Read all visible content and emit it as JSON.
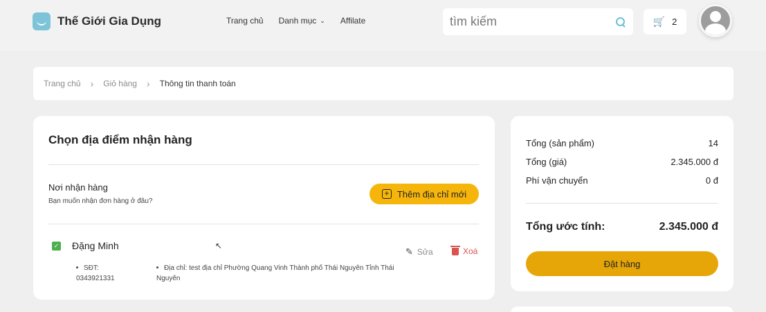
{
  "header": {
    "brand": "Thế Giới Gia Dụng",
    "nav": [
      {
        "label": "Trang chủ"
      },
      {
        "label": "Danh mục"
      },
      {
        "label": "Affilate"
      }
    ],
    "search": {
      "placeholder": "tìm kiếm"
    },
    "cart_count": "2"
  },
  "breadcrumb": {
    "items": [
      "Trang chủ",
      "Giỏ hàng"
    ],
    "current": "Thông tin thanh toán"
  },
  "address_panel": {
    "title": "Chọn địa điểm nhận hàng",
    "section_title": "Nơi nhận hàng",
    "section_sub": "Bạn muốn nhận đơn hàng ở đâu?",
    "add_button": "Thêm địa chỉ mới",
    "entry": {
      "name": "Đặng Minh",
      "selected": true,
      "phone_label": "SĐT:",
      "phone": "0343921331",
      "address_label": "Địa chỉ:",
      "address": "test địa chỉ Phường Quang Vinh Thành phố Thái Nguyên Tỉnh Thái Nguyên",
      "edit_label": "Sửa",
      "delete_label": "Xoá"
    }
  },
  "summary": {
    "rows": [
      {
        "label": "Tổng (sản phẩm)",
        "value": "14"
      },
      {
        "label": "Tổng (giá)",
        "value": "2.345.000 đ"
      },
      {
        "label": "Phí vận chuyển",
        "value": "0 đ"
      }
    ],
    "total_label": "Tổng ước tính:",
    "total_value": "2.345.000 đ",
    "order_button": "Đặt hàng"
  },
  "colors": {
    "accent": "#f5b50b",
    "order_button": "#e6a608",
    "delete": "#d9534f",
    "check": "#4caf50",
    "brand_icon": "#7dc4d8"
  }
}
